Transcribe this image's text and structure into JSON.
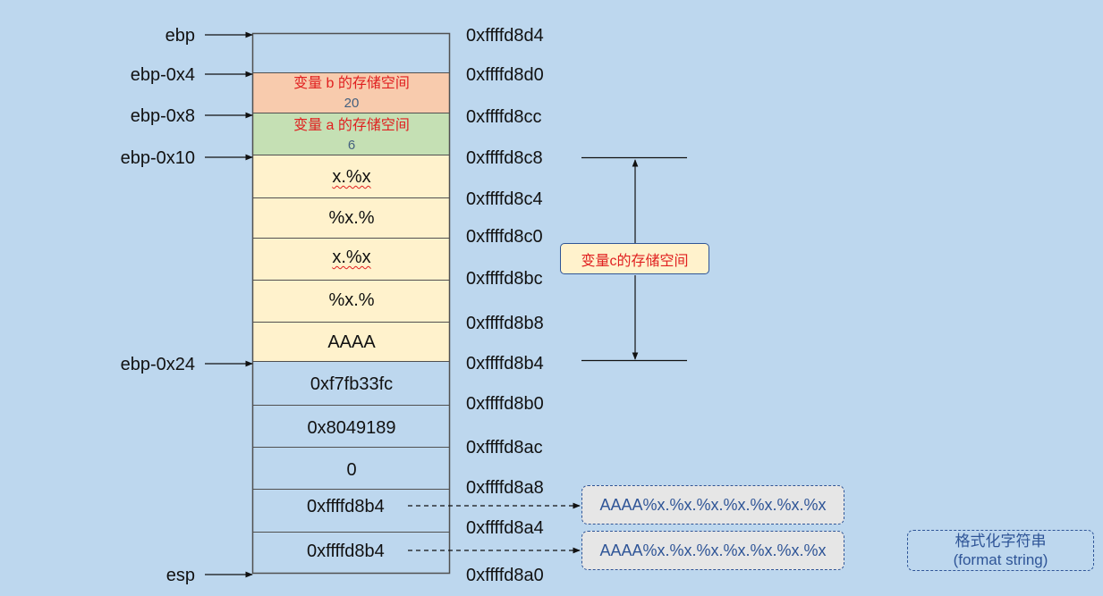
{
  "registers": {
    "ebp": "ebp",
    "ebp_0x4": "ebp-0x4",
    "ebp_0x8": "ebp-0x8",
    "ebp_0x10": "ebp-0x10",
    "ebp_0x24": "ebp-0x24",
    "esp": "esp"
  },
  "addresses": [
    "0xffffd8d4",
    "0xffffd8d0",
    "0xffffd8cc",
    "0xffffd8c8",
    "0xffffd8c4",
    "0xffffd8c0",
    "0xffffd8bc",
    "0xffffd8b8",
    "0xffffd8b4",
    "0xffffd8b0",
    "0xffffd8ac",
    "0xffffd8a8",
    "0xffffd8a4",
    "0xffffd8a0"
  ],
  "cells": {
    "var_b_label": "变量 b 的存储空间",
    "var_b_value": "20",
    "var_a_label": "变量 a 的存储空间",
    "var_a_value": "6",
    "c1": "x.%x",
    "c2": "%x.%",
    "c3": "x.%x",
    "c4": "%x.%",
    "c5": "AAAA",
    "s1": "0xf7fb33fc",
    "s2": "0x8049189",
    "s3": "0",
    "s4": "0xffffd8b4",
    "s5": "0xffffd8b4"
  },
  "callout": {
    "var_c": "变量c的存储空间"
  },
  "format_boxes": [
    "AAAA%x.%x.%x.%x.%x.%x.%x",
    "AAAA%x.%x.%x.%x.%x.%x.%x"
  ],
  "note": {
    "line1": "格式化字符串",
    "line2": "(format string)"
  },
  "colors": {
    "background": "#bdd7ee",
    "var_b_fill": "#f8cbad",
    "var_a_fill": "#c5e0b4",
    "string_fill": "#fff2cc",
    "label_red": "#e02020",
    "box_blue": "#2f5597"
  }
}
